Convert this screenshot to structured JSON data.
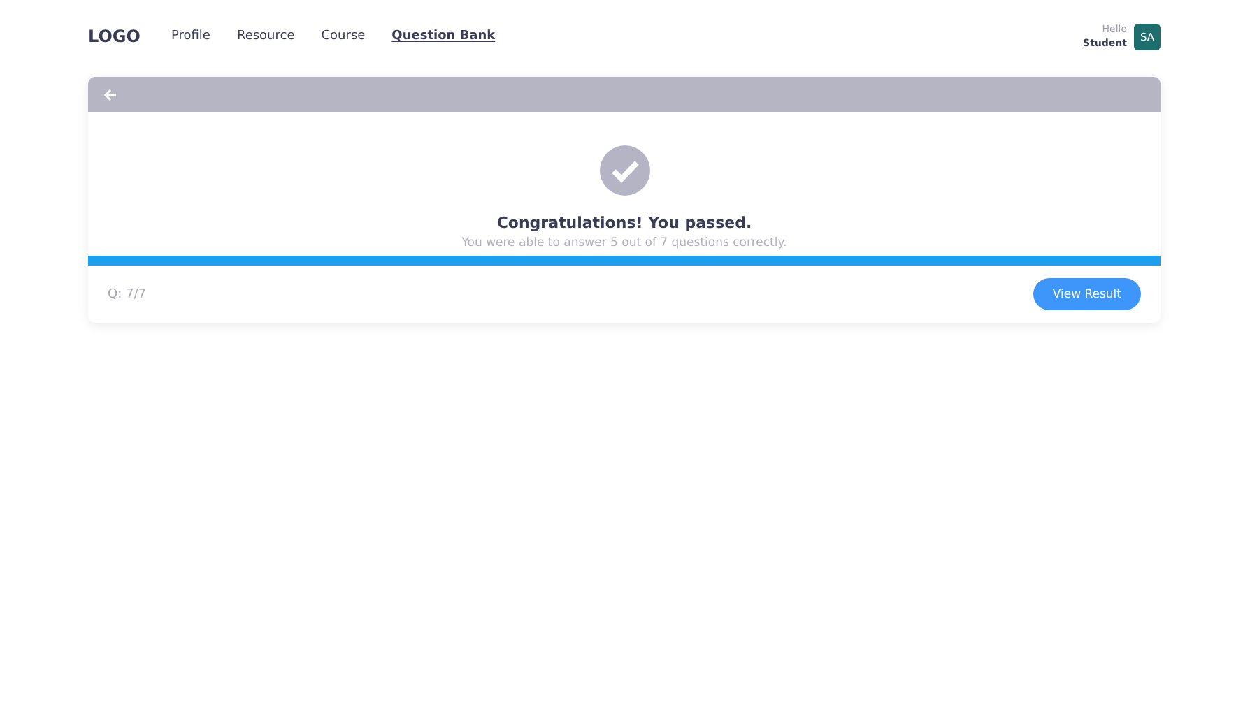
{
  "nav": {
    "logo": "LOGO",
    "links": [
      {
        "label": "Profile",
        "selected": false
      },
      {
        "label": "Resource",
        "selected": false
      },
      {
        "label": "Course",
        "selected": false
      },
      {
        "label": "Question Bank",
        "selected": true
      }
    ]
  },
  "user": {
    "greeting": "Hello",
    "name": "Student",
    "initials": "SA"
  },
  "result": {
    "title": "Congratulations! You passed.",
    "message": "You were able to answer 5 out of 7 questions correctly.",
    "progress": {
      "level": 1
    },
    "counter": "Q: 7/7",
    "button": "View Result"
  }
}
